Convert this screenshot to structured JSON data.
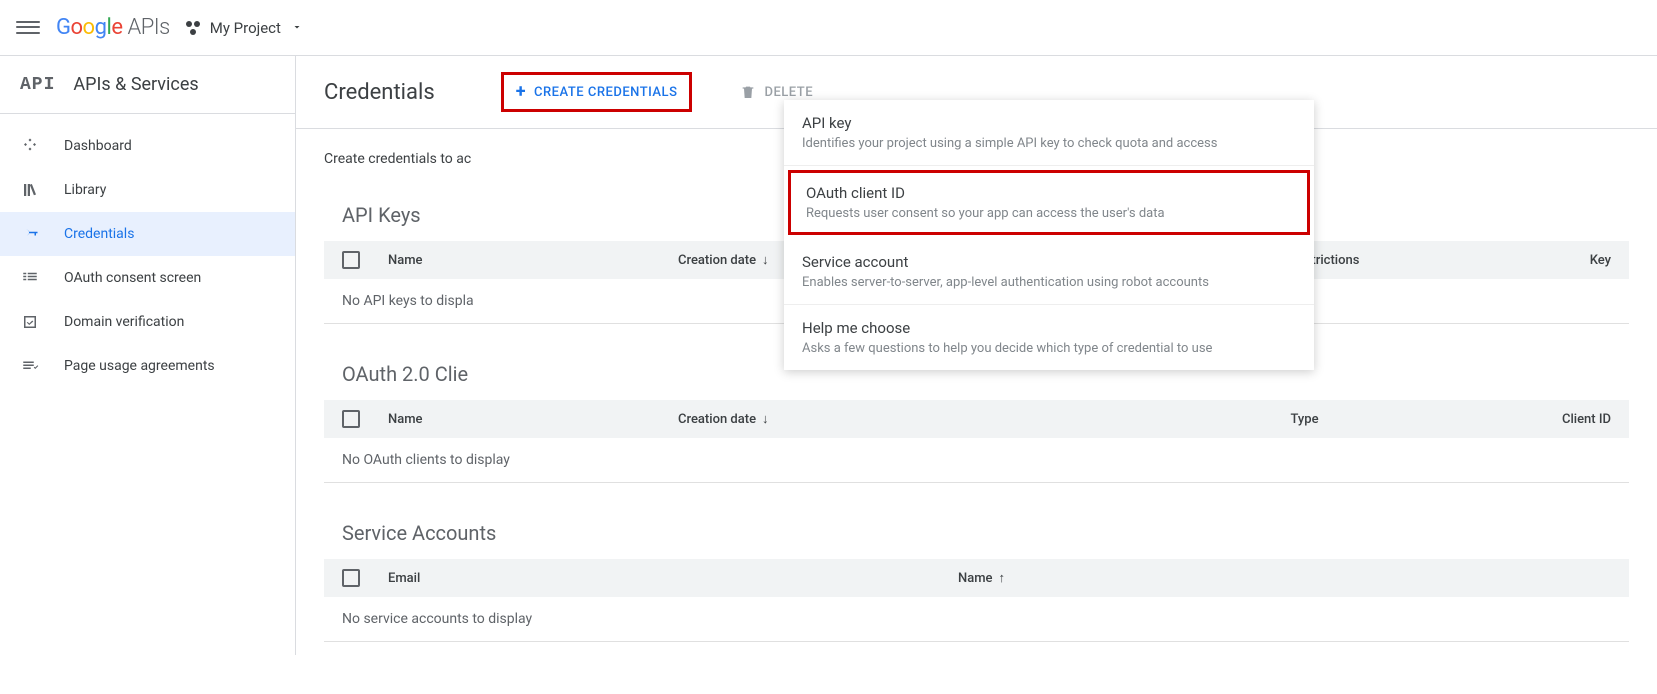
{
  "header": {
    "logo_text": "APIs",
    "project_name": "My Project"
  },
  "sidebar": {
    "title": "APIs & Services",
    "api_icon_text": "API",
    "items": [
      {
        "label": "Dashboard"
      },
      {
        "label": "Library"
      },
      {
        "label": "Credentials"
      },
      {
        "label": "OAuth consent screen"
      },
      {
        "label": "Domain verification"
      },
      {
        "label": "Page usage agreements"
      }
    ]
  },
  "main": {
    "title": "Credentials",
    "create_label": "CREATE CREDENTIALS",
    "delete_label": "DELETE",
    "helper": "Create credentials to ac"
  },
  "dropdown": [
    {
      "title": "API key",
      "desc": "Identifies your project using a simple API key to check quota and access"
    },
    {
      "title": "OAuth client ID",
      "desc": "Requests user consent so your app can access the user's data"
    },
    {
      "title": "Service account",
      "desc": "Enables server-to-server, app-level authentication using robot accounts"
    },
    {
      "title": "Help me choose",
      "desc": "Asks a few questions to help you decide which type of credential to use"
    }
  ],
  "sections": {
    "api_keys": {
      "title": "API Keys",
      "cols": {
        "name": "Name",
        "date": "Creation date",
        "restr": "Restrictions",
        "key": "Key"
      },
      "empty": "No API keys to displa"
    },
    "oauth": {
      "title": "OAuth 2.0 Clie",
      "cols": {
        "name": "Name",
        "date": "Creation date",
        "type": "Type",
        "cid": "Client ID"
      },
      "empty": "No OAuth clients to display"
    },
    "service": {
      "title": "Service Accounts",
      "cols": {
        "email": "Email",
        "name": "Name"
      },
      "empty": "No service accounts to display"
    }
  }
}
